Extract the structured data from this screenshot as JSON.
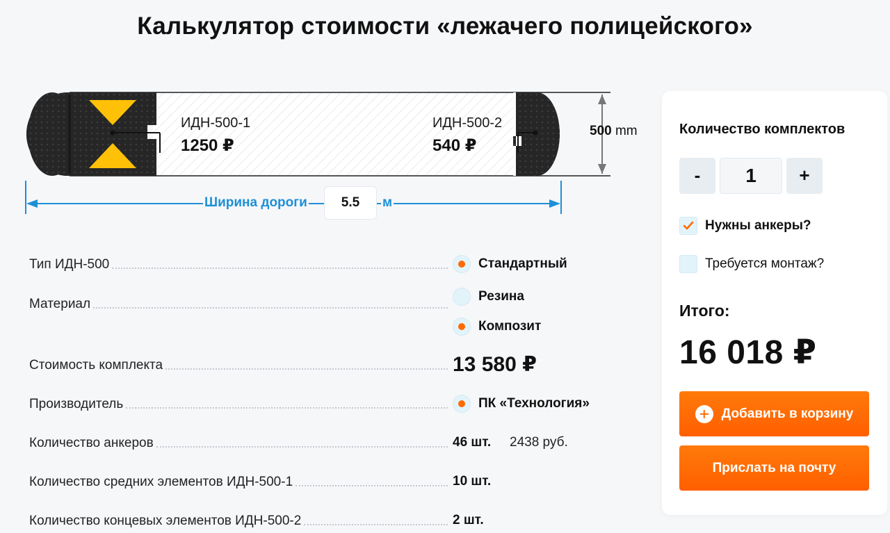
{
  "page": {
    "title": "Калькулятор стоимости «лежачего полицейского»"
  },
  "diagram": {
    "segment1": {
      "name": "ИДН-500-1",
      "price": "1250 ₽"
    },
    "segment2": {
      "name": "ИДН-500-2",
      "price": "540 ₽"
    },
    "height": {
      "value": "500",
      "unit": "mm"
    },
    "road_width": {
      "label": "Ширина дороги",
      "value": "5.5",
      "unit": "м"
    },
    "colors": {
      "accent_blue": "#1e8fd6",
      "rubber": "#222222",
      "marker": "#ffc107"
    }
  },
  "specs": {
    "type": {
      "label": "Тип ИДН-500",
      "options": [
        {
          "label": "Стандартный",
          "selected": true
        }
      ]
    },
    "material": {
      "label": "Материал",
      "options": [
        {
          "label": "Резина",
          "selected": false
        },
        {
          "label": "Композит",
          "selected": true
        }
      ]
    },
    "kit_cost": {
      "label": "Стоимость комплекта",
      "value": "13 580 ₽"
    },
    "manufacturer": {
      "label": "Производитель",
      "options": [
        {
          "label": "ПК «Технология»",
          "selected": true
        }
      ]
    },
    "anchors": {
      "label": "Количество анкеров",
      "count": "46 шт.",
      "price": "2438 руб."
    },
    "middle": {
      "label": "Количество средних элементов ИДН-500-1",
      "count": "10 шт."
    },
    "end": {
      "label": "Количество концевых элементов ИДН-500-2",
      "count": "2 шт."
    }
  },
  "panel": {
    "qty_title": "Количество комплектов",
    "minus": "-",
    "qty": "1",
    "plus": "+",
    "anchors_needed": {
      "label": "Нужны анкеры?",
      "checked": true
    },
    "install_needed": {
      "label": "Требуется монтаж?",
      "checked": false
    },
    "total_label": "Итого:",
    "total_value": "16 018 ₽",
    "add_to_cart": "Добавить в корзину",
    "send_email": "Прислать на почту",
    "colors": {
      "button": "#ff6a00"
    }
  }
}
